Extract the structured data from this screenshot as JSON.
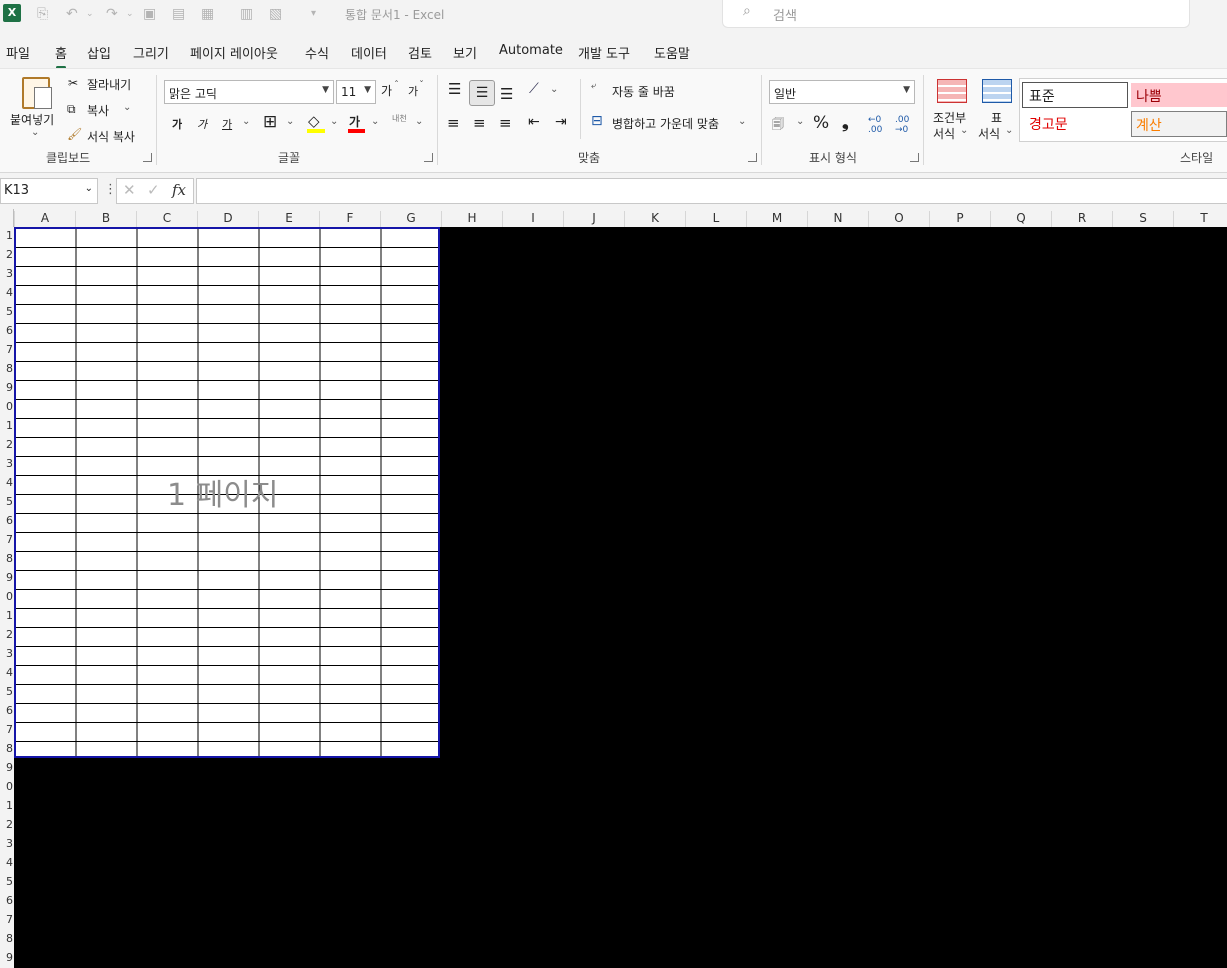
{
  "titlebar": {
    "title": "통합 문서1  -  Excel",
    "search_placeholder": "검색",
    "search_icon": "search-icon"
  },
  "menu": [
    "파일",
    "홈",
    "삽입",
    "그리기",
    "페이지 레이아웃",
    "수식",
    "데이터",
    "검토",
    "보기",
    "Automate",
    "개발 도구",
    "도움말"
  ],
  "ribbon": {
    "clipboard": {
      "paste": "붙여넣기",
      "cut": "잘라내기",
      "copy": "복사",
      "format_painter": "서식 복사",
      "label": "클립보드"
    },
    "font": {
      "name": "맑은 고딕",
      "size": "11",
      "grow": "가",
      "shrink": "가",
      "bold": "가",
      "italic": "가",
      "underline": "가",
      "font_color_glyph": "가",
      "phonetic": "내천",
      "label": "글꼴"
    },
    "alignment": {
      "wrap_text": "자동 줄 바꿈",
      "merge_center": "병합하고 가운데 맞춤",
      "label": "맞춤"
    },
    "number": {
      "format": "일반",
      "percent": "%",
      "comma": "❟",
      "label": "표시 형식"
    },
    "styles": {
      "conditional_l1": "조건부",
      "conditional_l2": "서식",
      "table_l1": "표",
      "table_l2": "서식",
      "normal": "표준",
      "bad": "나쁨",
      "warning": "경고문",
      "calculation": "계산",
      "label": "스타일"
    }
  },
  "formula_bar": {
    "name_box": "K13",
    "fx": "fx",
    "formula": ""
  },
  "columns": [
    "A",
    "B",
    "C",
    "D",
    "E",
    "F",
    "G",
    "H",
    "I",
    "J",
    "K",
    "L",
    "M",
    "N",
    "O",
    "P",
    "Q",
    "R",
    "S",
    "T"
  ],
  "rows": [
    "1",
    "2",
    "3",
    "4",
    "5",
    "6",
    "7",
    "8",
    "9",
    "0",
    "1",
    "2",
    "3",
    "4",
    "5",
    "6",
    "7",
    "8",
    "9",
    "0",
    "1",
    "2",
    "3",
    "4",
    "5",
    "6",
    "7",
    "8",
    "9",
    "0",
    "1",
    "2",
    "3",
    "4",
    "5",
    "6",
    "7",
    "8",
    "9"
  ],
  "page_break": {
    "label": "1 페이지"
  },
  "colors": {
    "accent": "#1e7145",
    "page_border": "#1515a8",
    "bad_fill": "#ffc7ce",
    "bad_text": "#9c0006",
    "warning_text": "#ff0000",
    "calc_text": "#fa7d00",
    "calc_fill": "#f2f2f2"
  }
}
